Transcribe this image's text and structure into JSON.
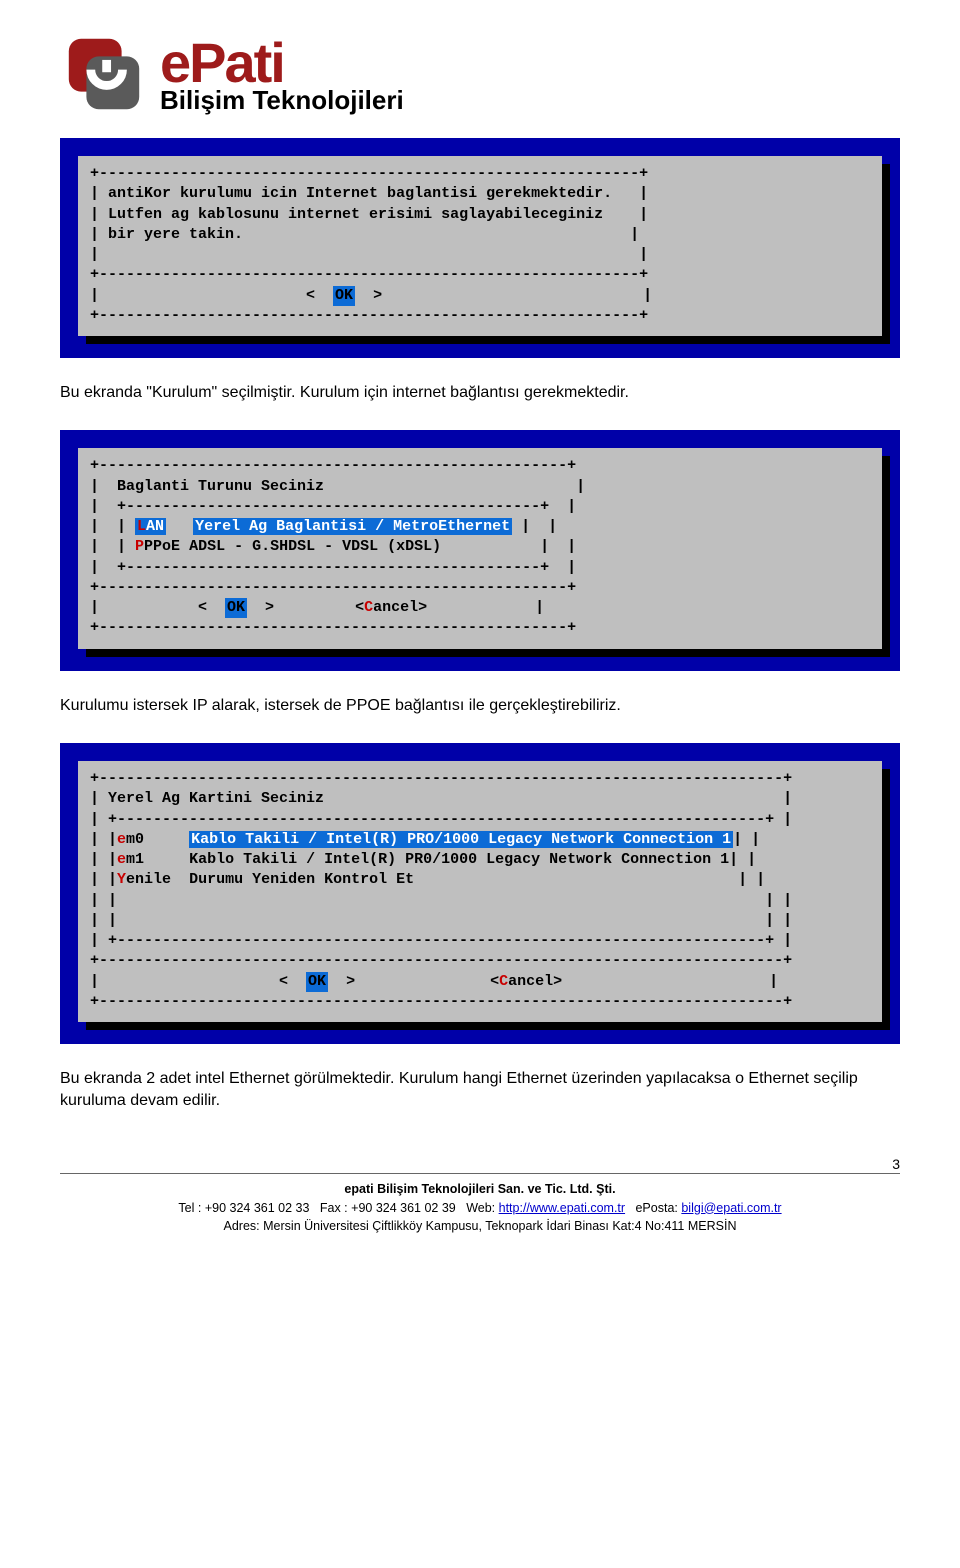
{
  "logo": {
    "brand": "ePati",
    "sub": "Bilişim Teknolojileri"
  },
  "term1": {
    "line1": "antiKor kurulumu icin Internet baglantisi gerekmektedir.",
    "line2": "Lutfen ag kablosunu internet erisimi saglayabileceginiz",
    "line3": "bir yere takin.",
    "ok": "OK"
  },
  "para1": "Bu ekranda \"Kurulum\" seçilmiştir. Kurulum için internet bağlantısı gerekmektedir.",
  "term2": {
    "title": "Baglanti Turunu Seciniz",
    "opt1_key": "L",
    "opt1_rest": "AN",
    "opt1_desc": "Yerel Ag Baglantisi / MetroEthernet",
    "opt2_key": "P",
    "opt2_rest": "PPoE",
    "opt2_desc": "ADSL - G.SHDSL - VDSL (xDSL)",
    "ok": "OK",
    "cancel_key": "C",
    "cancel_rest": "ancel"
  },
  "para2": "Kurulumu istersek IP alarak, istersek de PPOE bağlantısı ile gerçekleştirebiliriz.",
  "term3": {
    "title": "Yerel Ag Kartini Seciniz",
    "r1_key": "e",
    "r1_rest": "m0",
    "r1_desc": "Kablo Takili / Intel(R) PRO/1000 Legacy Network Connection 1",
    "r2_key": "e",
    "r2_rest": "m1",
    "r2_desc": "Kablo Takili / Intel(R) PR0/1000 Legacy Network Connection 1",
    "r3_key": "Y",
    "r3_rest": "enile",
    "r3_desc": "Durumu Yeniden Kontrol Et",
    "ok": "OK",
    "cancel_key": "C",
    "cancel_rest": "ancel"
  },
  "para3": "Bu ekranda 2 adet intel Ethernet görülmektedir. Kurulum hangi Ethernet üzerinden yapılacaksa o Ethernet seçilip kuruluma devam edilir.",
  "footer": {
    "company": "epati Bilişim Teknolojileri San. ve Tic. Ltd. Şti.",
    "tel_label": "Tel :",
    "tel": "+90 324 361 02 33",
    "fax_label": "Fax :",
    "fax": "+90 324 361 02 39",
    "web_label": "Web:",
    "web": "http://www.epati.com.tr",
    "email_label": "ePosta:",
    "email": "bilgi@epati.com.tr",
    "addr_label": "Adres:",
    "addr": "Mersin Üniversitesi Çiftlikköy Kampusu, Teknopark İdari Binası Kat:4 No:411 MERSİN",
    "page": "3"
  }
}
